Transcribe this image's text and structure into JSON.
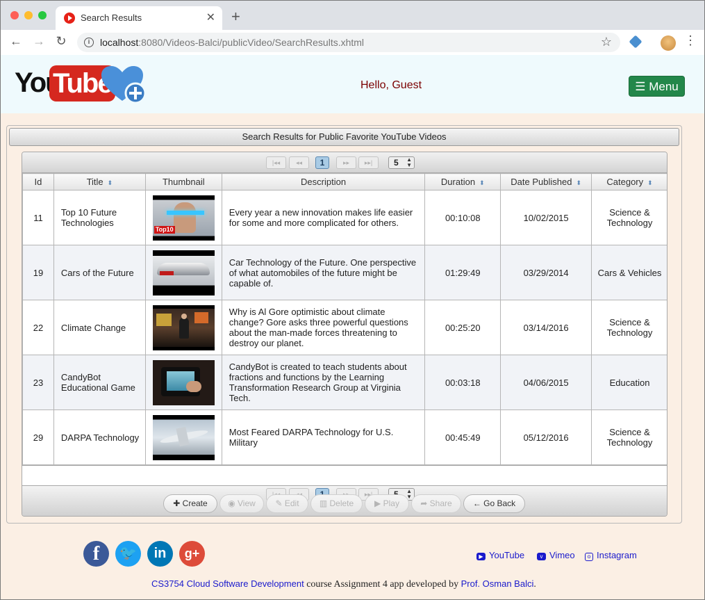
{
  "browser": {
    "tab_title": "Search Results",
    "new_tab": "+",
    "url_host": "localhost",
    "url_rest": ":8080/Videos-Balci/publicVideo/SearchResults.xhtml"
  },
  "header": {
    "logo_you": "You",
    "logo_tube": "Tube",
    "greeting": "Hello, Guest",
    "menu_label": "Menu"
  },
  "panel": {
    "title": "Search Results for Public Favorite YouTube Videos"
  },
  "pager": {
    "current_page": "1",
    "rows_per_page": "5"
  },
  "table": {
    "columns": [
      "Id",
      "Title",
      "Thumbnail",
      "Description",
      "Duration",
      "Date Published",
      "Category"
    ],
    "rows": [
      {
        "id": "11",
        "title": "Top 10 Future Technologies",
        "description": "Every year a new innovation makes life easier for some and more complicated for others.",
        "duration": "00:10:08",
        "date": "10/02/2015",
        "category": "Science & Technology"
      },
      {
        "id": "19",
        "title": "Cars of the Future",
        "description": "Car Technology of the Future. One perspective of what automobiles of the future might be capable of.",
        "duration": "01:29:49",
        "date": "03/29/2014",
        "category": "Cars & Vehicles"
      },
      {
        "id": "22",
        "title": "Climate Change",
        "description": "Why is Al Gore optimistic about climate change? Gore asks three powerful questions about the man-made forces threatening to destroy our planet.",
        "duration": "00:25:20",
        "date": "03/14/2016",
        "category": "Science & Technology"
      },
      {
        "id": "23",
        "title": "CandyBot Educational Game",
        "description": "CandyBot is created to teach students about fractions and functions by the Learning Transformation Research Group at Virginia Tech.",
        "duration": "00:03:18",
        "date": "04/06/2015",
        "category": "Education"
      },
      {
        "id": "29",
        "title": "DARPA Technology",
        "description": "Most Feared DARPA Technology for U.S. Military",
        "duration": "00:45:49",
        "date": "05/12/2016",
        "category": "Science & Technology"
      }
    ],
    "thumb_badge": "Top10"
  },
  "actions": {
    "create": "Create",
    "view": "View",
    "edit": "Edit",
    "delete": "Delete",
    "play": "Play",
    "share": "Share",
    "go_back": "Go Back"
  },
  "footer": {
    "youtube": "YouTube",
    "vimeo": "Vimeo",
    "instagram": "Instagram",
    "course_link": "CS3754 Cloud Software Development",
    "credits_mid": " course Assignment 4 app developed by ",
    "author_link": "Prof. Osman Balci",
    "credits_end": "."
  },
  "colors": {
    "accent_green": "#23874a",
    "header_bg": "#effafd",
    "page_bg": "#fbefe4",
    "link": "#1a1acc"
  }
}
